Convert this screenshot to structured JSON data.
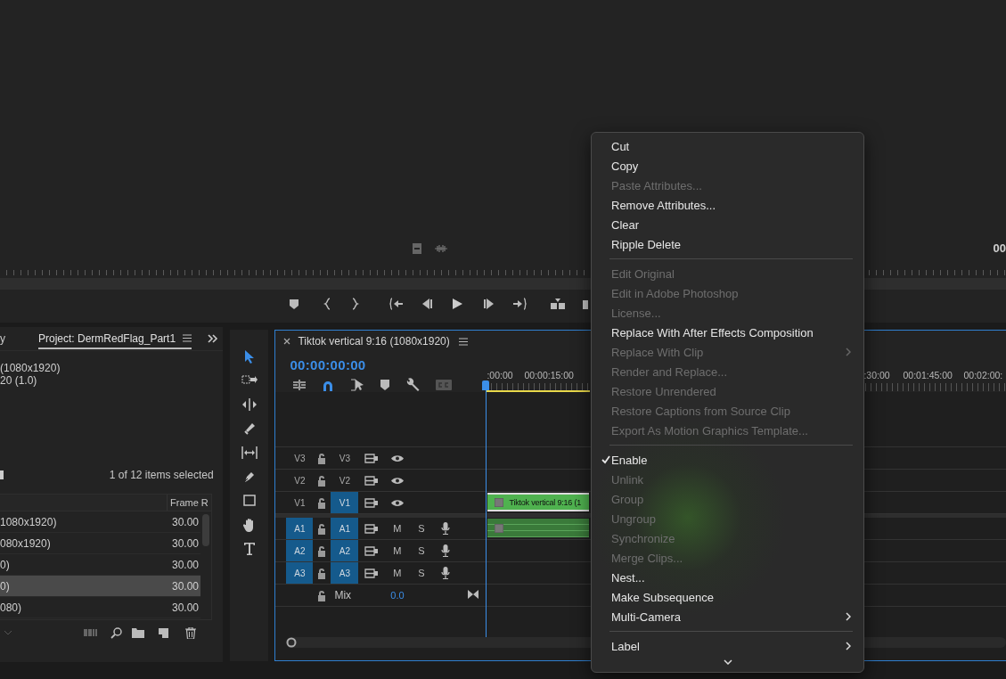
{
  "program_monitor": {
    "timecode": "00"
  },
  "project": {
    "cut_tab": "y",
    "tab": "Project: DermRedFlag_Part1",
    "info_lines": [
      "(1080x1920)",
      "20 (1.0)"
    ],
    "selection_count": "1 of 12 items selected",
    "column_2": "Frame R",
    "rows": [
      {
        "name": "1080x1920)",
        "frame_rate": "30.00",
        "selected": false
      },
      {
        "name": "080x1920)",
        "frame_rate": "30.00",
        "selected": false
      },
      {
        "name": "0)",
        "frame_rate": "30.00",
        "selected": false
      },
      {
        "name": "0)",
        "frame_rate": "30.00",
        "selected": true
      },
      {
        "name": "080)",
        "frame_rate": "30.00",
        "selected": false
      }
    ]
  },
  "tools": [
    {
      "kind": "selection",
      "selected": true
    },
    {
      "kind": "track_select",
      "selected": false
    },
    {
      "kind": "ripple",
      "selected": false
    },
    {
      "kind": "razor",
      "selected": false
    },
    {
      "kind": "slip",
      "selected": false
    },
    {
      "kind": "pen",
      "selected": false
    },
    {
      "kind": "rectangle",
      "selected": false
    },
    {
      "kind": "hand",
      "selected": false
    },
    {
      "kind": "type",
      "selected": false
    }
  ],
  "timeline": {
    "title": "Tiktok vertical 9:16 (1080x1920)",
    "timecode": "00:00:00:00",
    "snap": true,
    "ruler_labels": [
      ":00:00",
      "00:00:15:00",
      ":30:00",
      "00:01:45:00",
      "00:02:00:"
    ],
    "tracks": [
      {
        "kind": "video",
        "source_label": "V3",
        "source_patched": false,
        "target_label": "V3",
        "targeted": false
      },
      {
        "kind": "video",
        "source_label": "V2",
        "source_patched": false,
        "target_label": "V2",
        "targeted": false
      },
      {
        "kind": "video",
        "source_label": "V1",
        "source_patched": false,
        "target_label": "V1",
        "targeted": true
      },
      {
        "kind": "audio",
        "source_label": "A1",
        "source_patched": true,
        "target_label": "A1",
        "targeted": true,
        "mute": "M",
        "solo": "S"
      },
      {
        "kind": "audio",
        "source_label": "A2",
        "source_patched": true,
        "target_label": "A2",
        "targeted": true,
        "mute": "M",
        "solo": "S"
      },
      {
        "kind": "audio",
        "source_label": "A3",
        "source_patched": true,
        "target_label": "A3",
        "targeted": true,
        "mute": "M",
        "solo": "S"
      }
    ],
    "mix": {
      "label": "Mix",
      "value": "0.0"
    },
    "clips": [
      {
        "kind": "video",
        "label": "Tiktok vertical 9:16 (1"
      },
      {
        "kind": "audio"
      }
    ]
  },
  "context_menu": {
    "items": [
      {
        "kind": "item",
        "label": "Cut",
        "disabled": false,
        "checked": false,
        "submenu": false
      },
      {
        "kind": "item",
        "label": "Copy",
        "disabled": false,
        "checked": false,
        "submenu": false
      },
      {
        "kind": "item",
        "label": "Paste Attributes...",
        "disabled": true,
        "checked": false,
        "submenu": false
      },
      {
        "kind": "item",
        "label": "Remove Attributes...",
        "disabled": false,
        "checked": false,
        "submenu": false
      },
      {
        "kind": "item",
        "label": "Clear",
        "disabled": false,
        "checked": false,
        "submenu": false
      },
      {
        "kind": "item",
        "label": "Ripple Delete",
        "disabled": false,
        "checked": false,
        "submenu": false
      },
      {
        "kind": "separator"
      },
      {
        "kind": "item",
        "label": "Edit Original",
        "disabled": true,
        "checked": false,
        "submenu": false
      },
      {
        "kind": "item",
        "label": "Edit in Adobe Photoshop",
        "disabled": true,
        "checked": false,
        "submenu": false
      },
      {
        "kind": "item",
        "label": "License...",
        "disabled": true,
        "checked": false,
        "submenu": false
      },
      {
        "kind": "item",
        "label": "Replace With After Effects Composition",
        "disabled": false,
        "checked": false,
        "submenu": false
      },
      {
        "kind": "item",
        "label": "Replace With Clip",
        "disabled": true,
        "checked": false,
        "submenu": true
      },
      {
        "kind": "item",
        "label": "Render and Replace...",
        "disabled": true,
        "checked": false,
        "submenu": false
      },
      {
        "kind": "item",
        "label": "Restore Unrendered",
        "disabled": true,
        "checked": false,
        "submenu": false
      },
      {
        "kind": "item",
        "label": "Restore Captions from Source Clip",
        "disabled": true,
        "checked": false,
        "submenu": false
      },
      {
        "kind": "item",
        "label": "Export As Motion Graphics Template...",
        "disabled": true,
        "checked": false,
        "submenu": false
      },
      {
        "kind": "separator"
      },
      {
        "kind": "item",
        "label": "Enable",
        "disabled": false,
        "checked": true,
        "submenu": false
      },
      {
        "kind": "item",
        "label": "Unlink",
        "disabled": true,
        "checked": false,
        "submenu": false
      },
      {
        "kind": "item",
        "label": "Group",
        "disabled": true,
        "checked": false,
        "submenu": false
      },
      {
        "kind": "item",
        "label": "Ungroup",
        "disabled": true,
        "checked": false,
        "submenu": false
      },
      {
        "kind": "item",
        "label": "Synchronize",
        "disabled": true,
        "checked": false,
        "submenu": false
      },
      {
        "kind": "item",
        "label": "Merge Clips...",
        "disabled": true,
        "checked": false,
        "submenu": false
      },
      {
        "kind": "item",
        "label": "Nest...",
        "disabled": false,
        "checked": false,
        "submenu": false
      },
      {
        "kind": "item",
        "label": "Make Subsequence",
        "disabled": false,
        "checked": false,
        "submenu": false
      },
      {
        "kind": "item",
        "label": "Multi-Camera",
        "disabled": false,
        "checked": false,
        "submenu": true
      },
      {
        "kind": "separator"
      },
      {
        "kind": "item",
        "label": "Label",
        "disabled": false,
        "checked": false,
        "submenu": true
      }
    ]
  }
}
